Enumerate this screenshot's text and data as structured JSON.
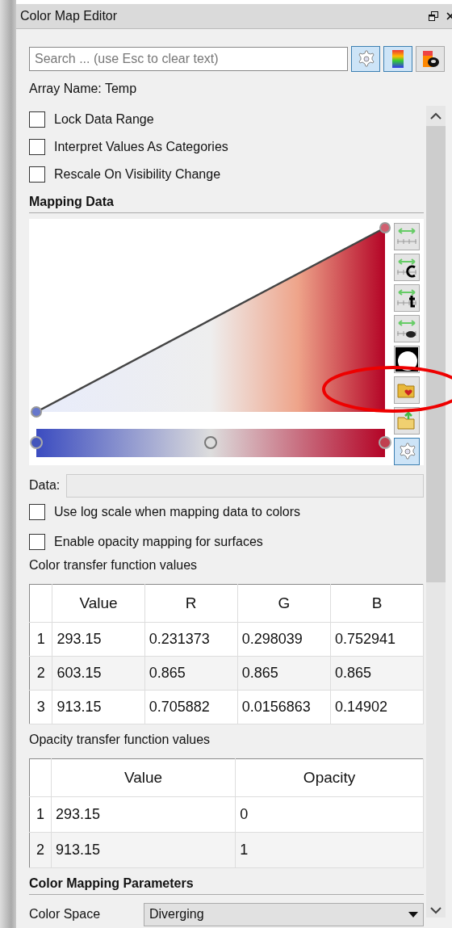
{
  "window": {
    "title": "Color Map Editor"
  },
  "search": {
    "placeholder": "Search ... (use Esc to clear text)"
  },
  "search_buttons": [
    {
      "kind": "gear",
      "pressed": true
    },
    {
      "kind": "presets",
      "pressed": true
    },
    {
      "kind": "edit",
      "pressed": false
    }
  ],
  "array_name": "Array Name: Temp",
  "options": [
    {
      "label": "Lock Data Range",
      "checked": false
    },
    {
      "label": "Interpret Values As Categories",
      "checked": false
    },
    {
      "label": "Rescale On Visibility Change",
      "checked": false
    }
  ],
  "mapping_data": {
    "heading": "Mapping Data",
    "side_buttons": [
      {
        "kind": "range",
        "pressed": false
      },
      {
        "kind": "custom",
        "pressed": false
      },
      {
        "kind": "time",
        "pressed": false
      },
      {
        "kind": "visible",
        "pressed": false
      },
      {
        "kind": "invert",
        "pressed": false
      },
      {
        "kind": "save",
        "pressed": false
      },
      {
        "kind": "import",
        "pressed": false
      },
      {
        "kind": "gear",
        "pressed": true
      }
    ],
    "data_label": "Data:",
    "options": [
      {
        "label": "Use log scale when mapping data to colors",
        "checked": false
      },
      {
        "label": "Enable opacity mapping for surfaces",
        "checked": false
      }
    ]
  },
  "color_table": {
    "title": "Color transfer function values",
    "columns": [
      "Value",
      "R",
      "G",
      "B"
    ],
    "rows": [
      {
        "index": "1",
        "cells": [
          "293.15",
          "0.231373",
          "0.298039",
          "0.752941"
        ]
      },
      {
        "index": "2",
        "cells": [
          "603.15",
          "0.865",
          "0.865",
          "0.865"
        ]
      },
      {
        "index": "3",
        "cells": [
          "913.15",
          "0.705882",
          "0.0156863",
          "0.14902"
        ]
      }
    ]
  },
  "opacity_table": {
    "title": "Opacity transfer function values",
    "columns": [
      "Value",
      "Opacity"
    ],
    "rows": [
      {
        "index": "1",
        "cells": [
          "293.15",
          "0"
        ]
      },
      {
        "index": "2",
        "cells": [
          "913.15",
          "1"
        ]
      }
    ]
  },
  "parameters": {
    "heading": "Color Mapping Parameters",
    "color_space_label": "Color Space",
    "color_space": "Diverging"
  }
}
